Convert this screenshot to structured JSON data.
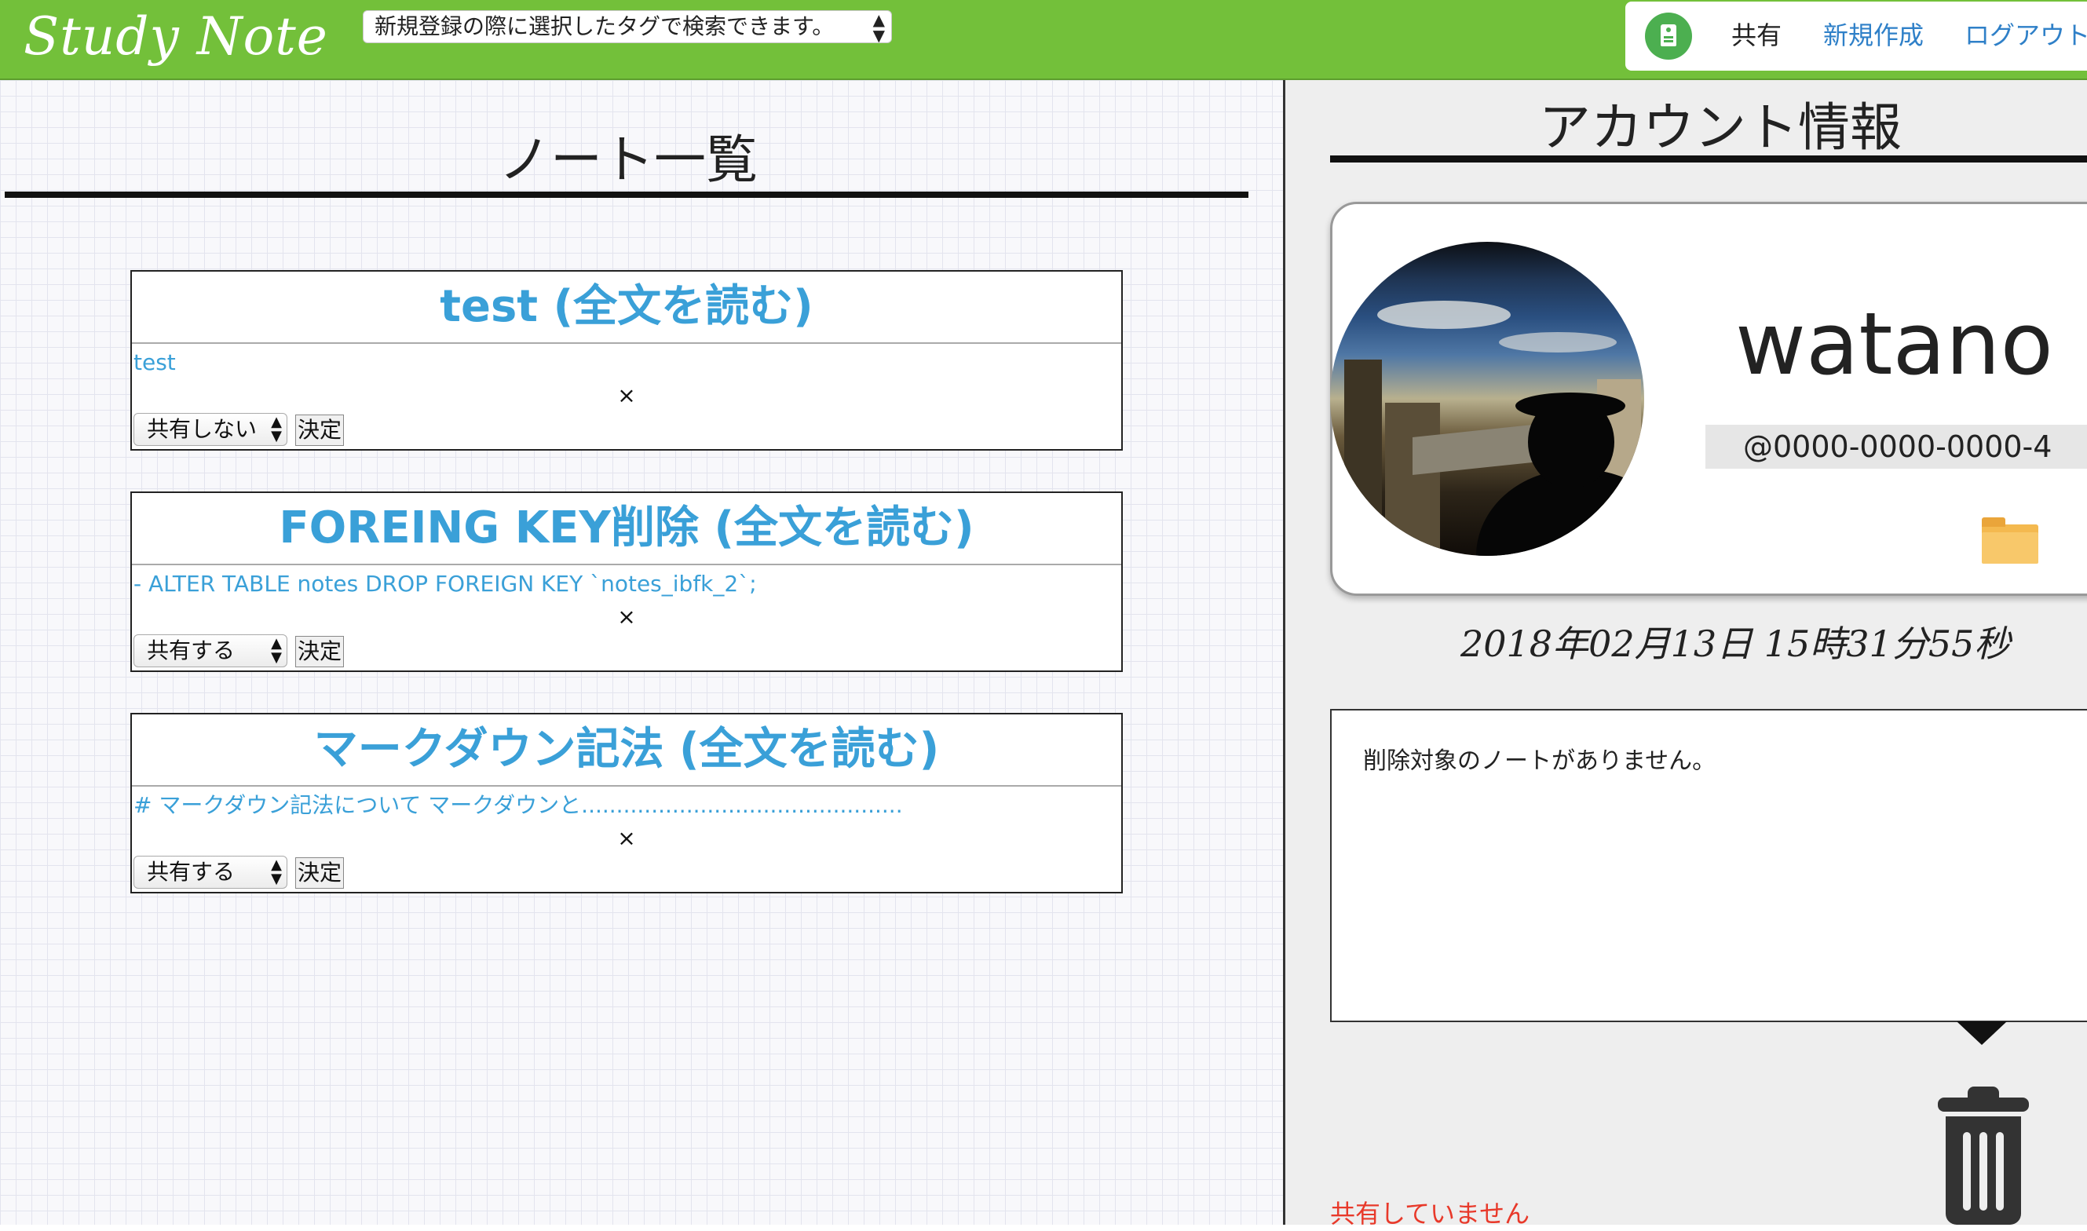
{
  "header": {
    "logo": "Study Note",
    "tag_select": {
      "value": "新規登録の際に選択したタグで検索できます。"
    },
    "nav": {
      "share": "共有",
      "new": "新規作成",
      "logout": "ログアウト"
    }
  },
  "notes_panel": {
    "title": "ノート一覧",
    "notes": [
      {
        "title": "test (全文を読む)",
        "excerpt": "test",
        "delete": "×",
        "share_option": "共有しない",
        "submit": "決定"
      },
      {
        "title": "FOREING KEY削除 (全文を読む)",
        "excerpt": "- ALTER TABLE notes DROP FOREIGN KEY `notes_ibfk_2`;",
        "delete": "×",
        "share_option": "共有する",
        "submit": "決定"
      },
      {
        "title": "マークダウン記法 (全文を読む)",
        "excerpt": "# マークダウン記法について マークダウンと..............................................",
        "delete": "×",
        "share_option": "共有する",
        "submit": "決定"
      }
    ]
  },
  "account_panel": {
    "title": "アカウント情報",
    "username": "watano",
    "user_id": "@0000-0000-0000-4",
    "timestamp": "2018年02月13日 15時31分55秒",
    "delete_message": "削除対象のノートがありません。",
    "share_status": "共有していません",
    "colors": {
      "accent": "#73c03a",
      "link": "#2f80c8",
      "note_title": "#3aa0d8",
      "alert": "#e8392a"
    },
    "icons": [
      "tag-icon",
      "folder-icon",
      "trash-icon"
    ]
  }
}
